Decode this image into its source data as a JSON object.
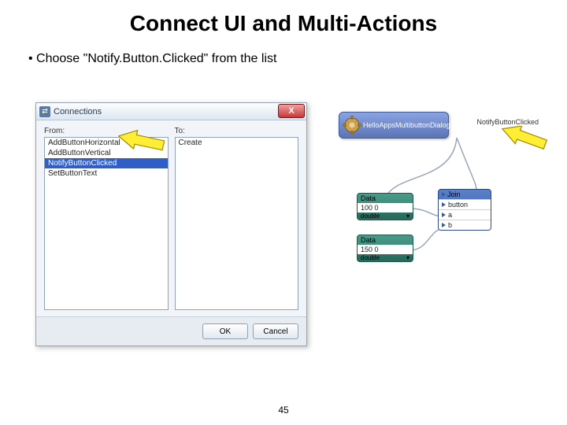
{
  "title": "Connect UI and Multi-Actions",
  "bullet": "Choose \"Notify.Button.Clicked\" from the list",
  "dialog": {
    "title": "Connections",
    "close": "X",
    "from_label": "From:",
    "to_label": "To:",
    "from_items": [
      "AddButtonHorizontal",
      "AddButtonVertical",
      "NotifyButtonClicked",
      "SetButtonText"
    ],
    "to_items": [
      "Create"
    ],
    "ok": "OK",
    "cancel": "Cancel",
    "selected_index": 2
  },
  "diagram": {
    "hello_node": "HelloAppsMultibuttonDialog",
    "event_label": "NotifyButtonClicked",
    "data_hdr": "Data",
    "data1_val": "100 0",
    "data1_type": "double",
    "data2_val": "150 0",
    "data2_type": "double",
    "dropdown": "▾",
    "join_hdr": "Join",
    "join_rows": [
      "button",
      "a",
      "b"
    ]
  },
  "page_number": "45"
}
